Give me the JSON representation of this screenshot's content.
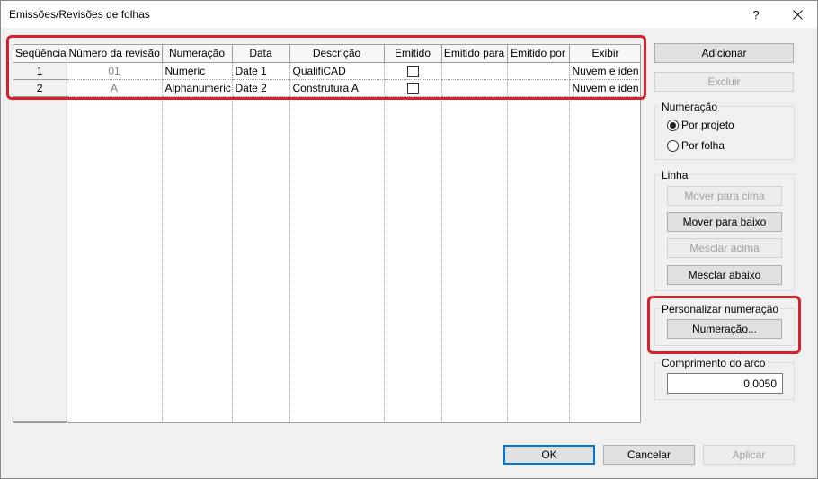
{
  "window": {
    "title": "Emissões/Revisões de folhas",
    "help_label": "?"
  },
  "table": {
    "columns": [
      "Seqüência",
      "Número da revisão",
      "Numeração",
      "Data",
      "Descrição",
      "Emitido",
      "Emitido para",
      "Emitido por",
      "Exibir"
    ],
    "rows": [
      {
        "seq": "1",
        "revision_number": "01",
        "numbering": "Numeric",
        "date": "Date 1",
        "description": "QualifiCAD",
        "issued": false,
        "issued_to": "",
        "issued_by": "",
        "show": "Nuvem e iden"
      },
      {
        "seq": "2",
        "revision_number": "A",
        "numbering": "Alphanumeric",
        "date": "Date 2",
        "description": "Construtura A",
        "issued": false,
        "issued_to": "",
        "issued_by": "",
        "show": "Nuvem e iden"
      }
    ]
  },
  "actions": {
    "add": "Adicionar",
    "delete": "Excluir"
  },
  "numbering_group": {
    "label": "Numeração",
    "by_project": "Por projeto",
    "by_sheet": "Por folha",
    "selected": "by_project"
  },
  "row_group": {
    "label": "Linha",
    "move_up": "Mover para cima",
    "move_down": "Mover para baixo",
    "merge_up": "Mesclar acima",
    "merge_down": "Mesclar abaixo"
  },
  "custom_numbering": {
    "label": "Personalizar numeração",
    "button": "Numeração..."
  },
  "arc_length": {
    "label": "Comprimento do arco",
    "value": "0.0050"
  },
  "footer": {
    "ok": "OK",
    "cancel": "Cancelar",
    "apply": "Aplicar"
  },
  "colors": {
    "highlight": "#d6202b",
    "default_button_border": "#0078d7"
  }
}
